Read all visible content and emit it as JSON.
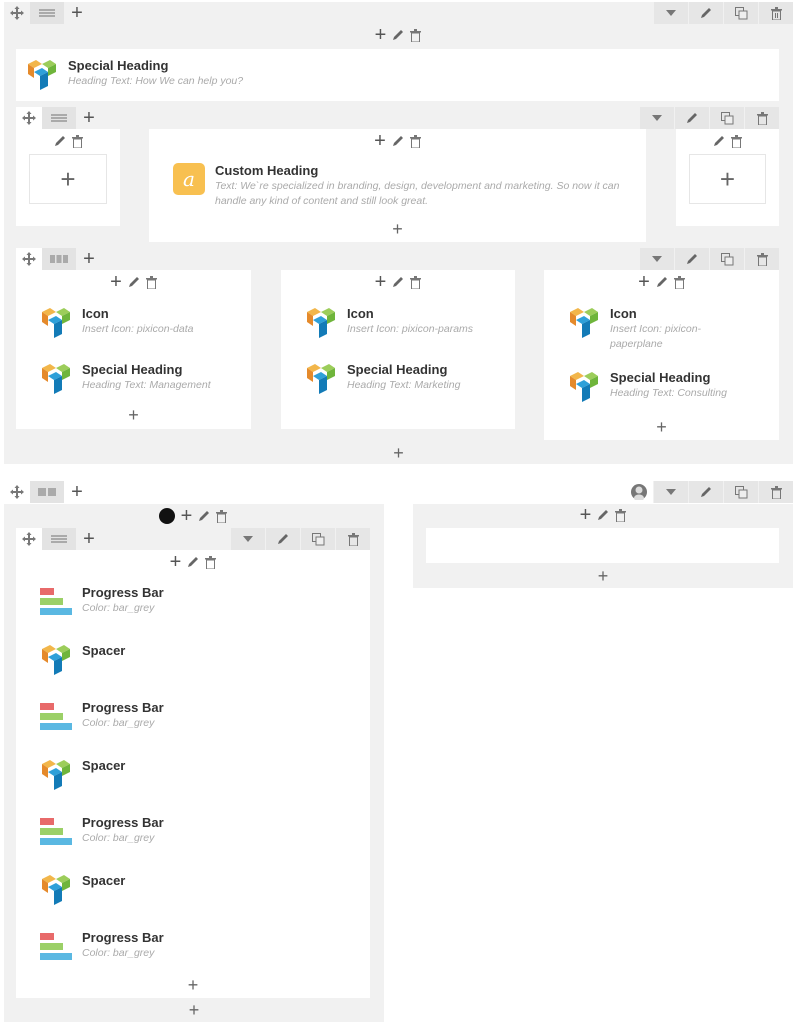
{
  "row1": {
    "special_heading": {
      "name": "Special Heading",
      "desc": "Heading Text: How We can help you?"
    },
    "custom_heading": {
      "name": "Custom Heading",
      "desc": "Text: We`re specialized in branding, design, development and marketing. So now it can handle any kind of content and still look great.",
      "badge": "a"
    },
    "columns": [
      {
        "items": [
          {
            "type": "vc",
            "name": "Icon",
            "desc": "Insert Icon: pixicon-data"
          },
          {
            "type": "vc",
            "name": "Special Heading",
            "desc": "Heading Text: Management"
          }
        ]
      },
      {
        "items": [
          {
            "type": "vc",
            "name": "Icon",
            "desc": "Insert Icon: pixicon-params"
          },
          {
            "type": "vc",
            "name": "Special Heading",
            "desc": "Heading Text: Marketing"
          }
        ]
      },
      {
        "items": [
          {
            "type": "vc",
            "name": "Icon",
            "desc": "Insert Icon: pixicon-paperplane"
          },
          {
            "type": "vc",
            "name": "Special Heading",
            "desc": "Heading Text: Consulting"
          }
        ]
      }
    ]
  },
  "row2": {
    "items": [
      {
        "type": "pb",
        "name": "Progress Bar",
        "desc": "Color: bar_grey"
      },
      {
        "type": "vc",
        "name": "Spacer",
        "desc": ""
      },
      {
        "type": "pb",
        "name": "Progress Bar",
        "desc": "Color: bar_grey"
      },
      {
        "type": "vc",
        "name": "Spacer",
        "desc": ""
      },
      {
        "type": "pb",
        "name": "Progress Bar",
        "desc": "Color: bar_grey"
      },
      {
        "type": "vc",
        "name": "Spacer",
        "desc": ""
      },
      {
        "type": "pb",
        "name": "Progress Bar",
        "desc": "Color: bar_grey"
      }
    ]
  },
  "icons": {
    "move": "move-icon",
    "grid": "layout-grid-icon",
    "add": "plus-icon",
    "toggle": "chevron-down-icon",
    "edit": "pencil-icon",
    "clone": "clone-icon",
    "delete": "trash-icon"
  },
  "colors": {
    "accent_orange": "#f8c050",
    "bar_red": "#e86a6a",
    "bar_green": "#9bd067",
    "bar_blue": "#5ab8e2"
  }
}
